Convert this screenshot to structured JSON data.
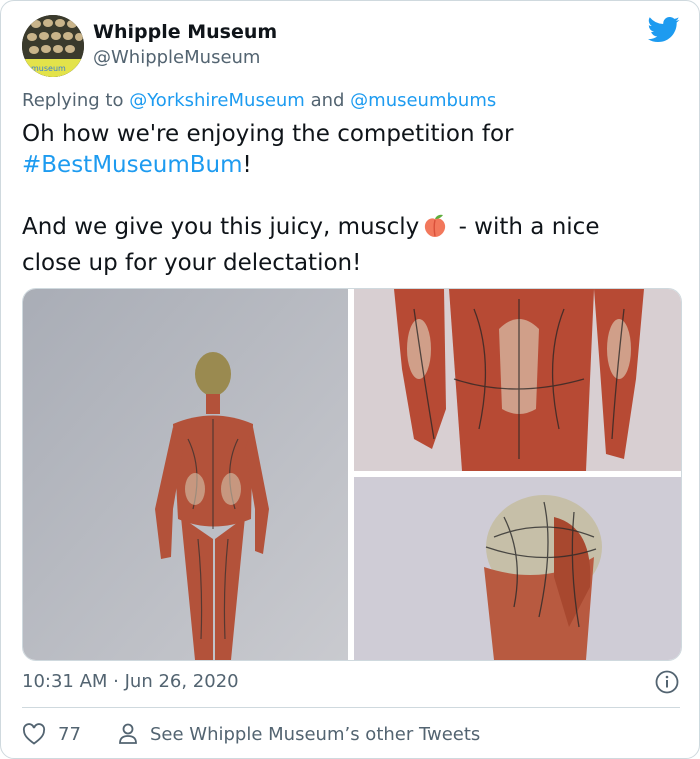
{
  "tweet": {
    "display_name": "Whipple Museum",
    "handle": "@WhippleMuseum",
    "replying_prefix": "Replying to ",
    "reply_to_1": "@YorkshireMuseum",
    "reply_and": " and ",
    "reply_to_2": "@museumbums",
    "line1": "Oh how we're enjoying the competition for",
    "hashtag": "#BestMuseumBum",
    "line2_end": "!",
    "line3_start": "And we give you this juicy, muscly",
    "line3_end": " - with a nice",
    "line4": "close up for your delectation!",
    "avatar_badge": "museum",
    "timestamp": "10:31 AM · Jun 26, 2020",
    "like_count": "77",
    "other_tweets_label": "See Whipple Museum’s other Tweets"
  },
  "icons": {
    "brand": "twitter-bird-icon",
    "emoji": "peach-emoji",
    "info": "info-icon",
    "like": "heart-icon",
    "profile": "person-icon"
  },
  "colors": {
    "link": "#1d9bf0",
    "secondary_text": "#536471",
    "border": "#cfd9de"
  }
}
